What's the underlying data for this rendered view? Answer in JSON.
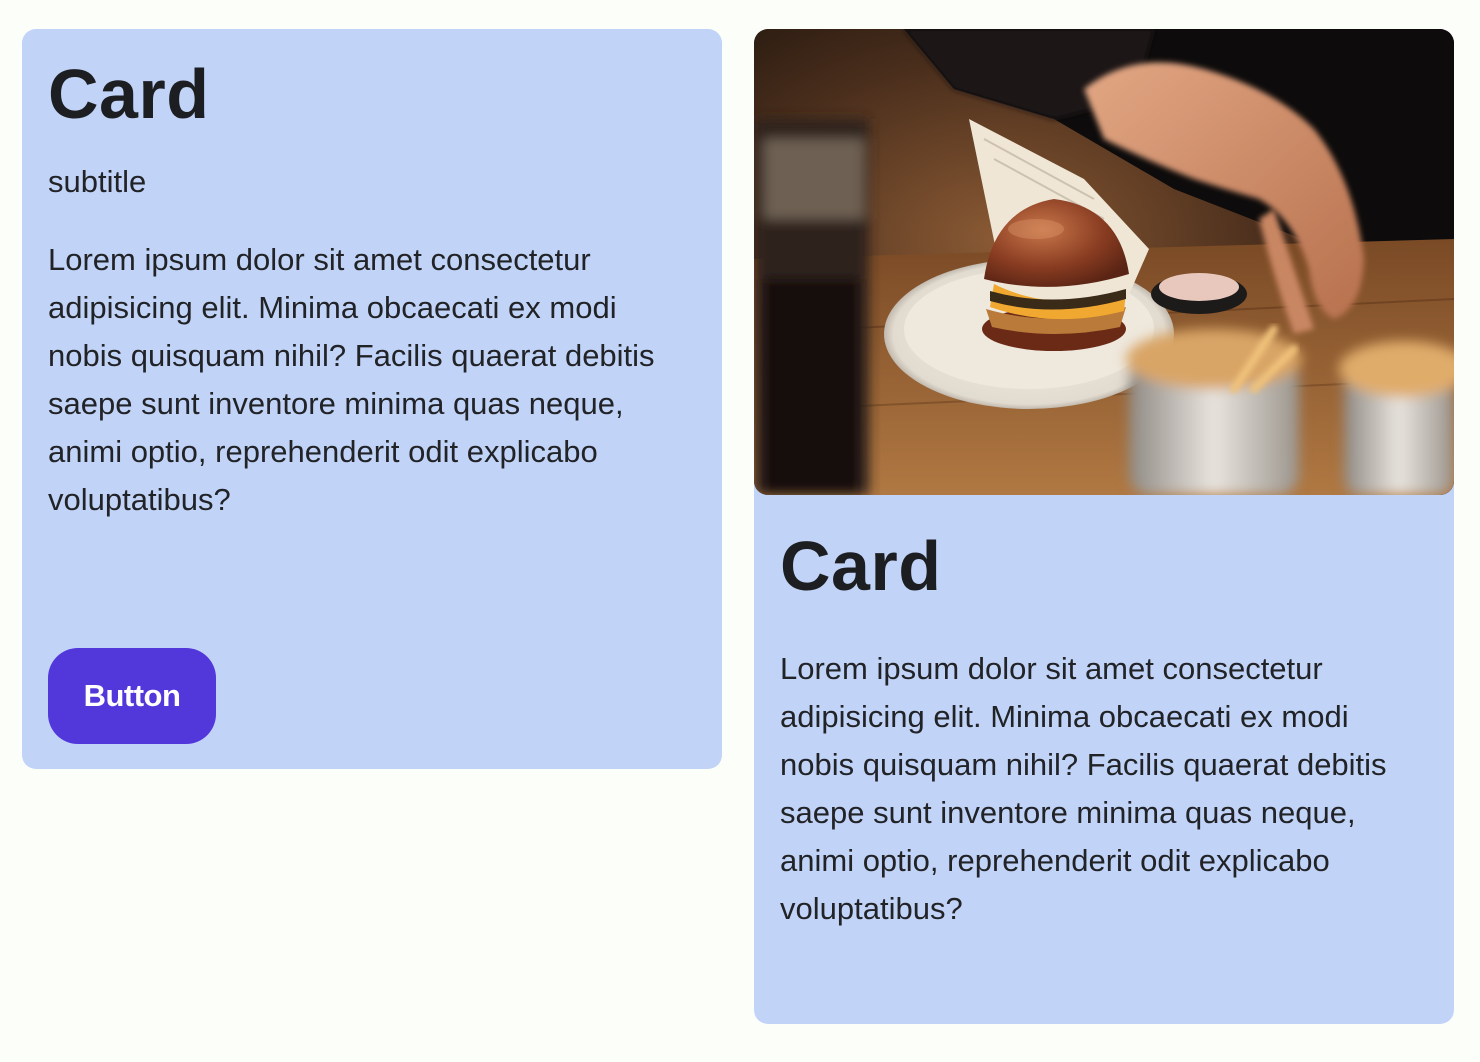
{
  "cards": [
    {
      "title": "Card",
      "subtitle": "subtitle",
      "body": "Lorem ipsum dolor sit amet consectetur adipisicing elit. Minima obcaecati ex modi nobis quisquam nihil? Facilis quaerat debitis saepe sunt inventore minima quas neque, animi optio, reprehenderit odit explicabo voluptatibus?",
      "button_label": "Button"
    },
    {
      "image": "burger-and-fries-photo",
      "title": "Card",
      "body": "Lorem ipsum dolor sit amet consectetur adipisicing elit. Minima obcaecati ex modi nobis quisquam nihil? Facilis quaerat debitis saepe sunt inventore minima quas neque, animi optio, reprehenderit odit explicabo voluptatibus?"
    }
  ],
  "colors": {
    "page_background": "#fcfef9",
    "card_background": "#c1d4f8",
    "button_background": "#5237db",
    "button_text": "#ffffff",
    "text": "#1e1f24"
  }
}
